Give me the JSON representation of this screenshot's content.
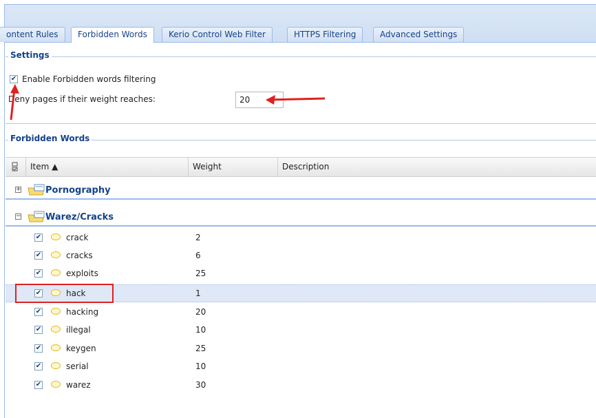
{
  "tabs": [
    {
      "label": "ontent Rules",
      "active": false
    },
    {
      "label": "Forbidden Words",
      "active": true
    },
    {
      "label": "Kerio Control Web Filter",
      "active": false
    },
    {
      "label": "HTTPS Filtering",
      "active": false
    },
    {
      "label": "Advanced Settings",
      "active": false
    }
  ],
  "settings": {
    "legend": "Settings",
    "enable_label": "Enable Forbidden words filtering",
    "enable_checked": true,
    "deny_label": "Deny pages if their weight reaches:",
    "deny_value": "20"
  },
  "forbidden": {
    "legend": "Forbidden Words",
    "columns": {
      "item": "Item ▲",
      "weight": "Weight",
      "description": "Description"
    },
    "groups": [
      {
        "name": "Pornography",
        "expanded": false,
        "expander": "+"
      },
      {
        "name": "Warez/Cracks",
        "expanded": true,
        "expander": "−"
      }
    ],
    "rows": [
      {
        "item": "crack",
        "weight": "2",
        "checked": true
      },
      {
        "item": "cracks",
        "weight": "6",
        "checked": true
      },
      {
        "item": "exploits",
        "weight": "25",
        "checked": true
      },
      {
        "item": "hack",
        "weight": "1",
        "checked": true
      },
      {
        "item": "hacking",
        "weight": "20",
        "checked": true
      },
      {
        "item": "illegal",
        "weight": "10",
        "checked": true
      },
      {
        "item": "keygen",
        "weight": "25",
        "checked": true
      },
      {
        "item": "serial",
        "weight": "10",
        "checked": true
      },
      {
        "item": "warez",
        "weight": "30",
        "checked": true
      }
    ],
    "selected_row": "hack"
  },
  "icons": {
    "check": "✔",
    "folder": "folder-icon",
    "word": "speech-bubble-icon"
  },
  "colors": {
    "accent": "#15428b",
    "annotation": "#e02020",
    "selection": "#dfe8f6"
  }
}
